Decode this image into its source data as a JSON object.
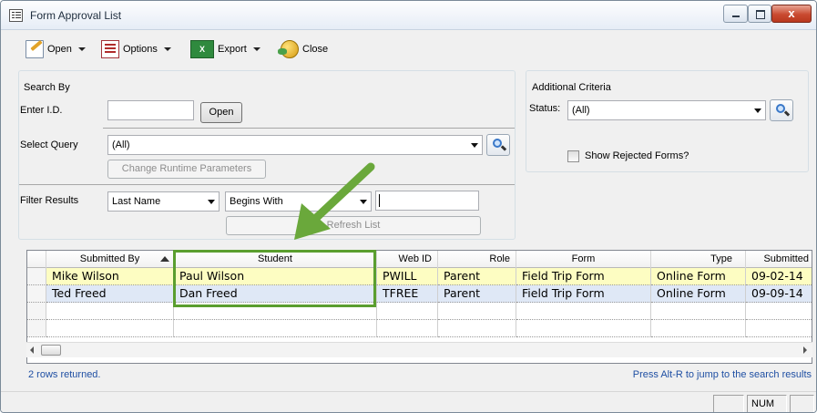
{
  "window": {
    "title": "Form Approval List",
    "close_glyph": "x"
  },
  "toolbar": {
    "open_label": "Open",
    "options_label": "Options",
    "export_label": "Export",
    "close_label": "Close",
    "export_icon_text": "X"
  },
  "search_by": {
    "legend": "Search By",
    "enter_id_label": "Enter I.D.",
    "enter_id_value": "",
    "open_button": "Open",
    "select_query_label": "Select Query",
    "select_query_value": "(All)",
    "change_runtime_button": "Change Runtime Parameters",
    "filter_results_label": "Filter Results",
    "filter_field_value": "Last Name",
    "filter_operator_value": "Begins With",
    "filter_text_value": "",
    "refresh_button": "Refresh List"
  },
  "additional_criteria": {
    "legend": "Additional Criteria",
    "status_label": "Status:",
    "status_value": "(All)",
    "show_rejected_label": "Show Rejected Forms?",
    "show_rejected_checked": false
  },
  "grid": {
    "columns": [
      "Submitted By",
      "Student",
      "Web ID",
      "Role",
      "Form",
      "Type",
      "Submitted"
    ],
    "rows": [
      {
        "submitted_by": "Mike Wilson",
        "student": "Paul Wilson",
        "web_id": "PWILL",
        "role": "Parent",
        "form": "Field Trip Form",
        "type": "Online Form",
        "submitted": "09-02-14"
      },
      {
        "submitted_by": "Ted Freed",
        "student": "Dan Freed",
        "web_id": "TFREE",
        "role": "Parent",
        "form": "Field Trip Form",
        "type": "Online Form",
        "submitted": "09-09-14"
      }
    ],
    "row_colors": [
      "#fdfdc2",
      "#dfe8f6"
    ],
    "sort_column": "Submitted By"
  },
  "status": {
    "rows_returned": "2 rows returned.",
    "hint": "Press Alt-R to jump to the search results",
    "num_indicator": "NUM"
  },
  "colors": {
    "highlight": "#5a9e2f",
    "link_blue": "#1f4fa3"
  }
}
